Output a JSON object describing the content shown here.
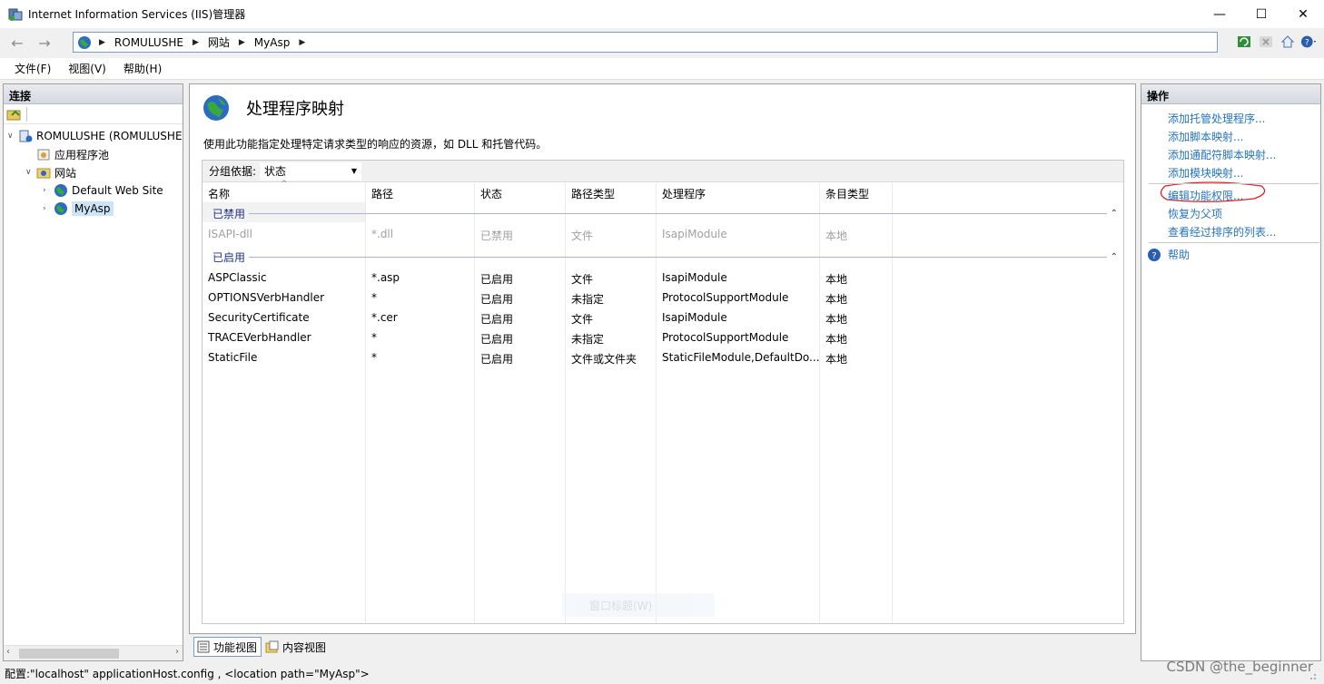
{
  "window": {
    "title": "Internet Information Services (IIS)管理器",
    "minimize": "—",
    "maximize": "☐",
    "close": "✕"
  },
  "address": {
    "back": "←",
    "forward": "→",
    "crumbs": [
      "ROMULUSHE",
      "网站",
      "MyAsp"
    ]
  },
  "menu": [
    "文件(F)",
    "视图(V)",
    "帮助(H)"
  ],
  "connections": {
    "header": "连接",
    "tree": [
      {
        "label": "ROMULUSHE (ROMULUSHE",
        "expanded": true
      },
      {
        "label": "应用程序池"
      },
      {
        "label": "网站",
        "expanded": true
      },
      {
        "label": "Default Web Site",
        "expanded": false
      },
      {
        "label": "MyAsp",
        "expanded": false,
        "selected": true
      }
    ]
  },
  "main": {
    "title": "处理程序映射",
    "description": "使用此功能指定处理特定请求类型的响应的资源，如 DLL 和托管代码。",
    "group_by_label": "分组依据:",
    "group_by_value": "状态",
    "columns": [
      "名称",
      "路径",
      "状态",
      "路径类型",
      "处理程序",
      "条目类型"
    ],
    "groups": [
      {
        "name": "已禁用",
        "rows": [
          [
            "ISAPI-dll",
            "*.dll",
            "已禁用",
            "文件",
            "IsapiModule",
            "本地"
          ]
        ]
      },
      {
        "name": "已启用",
        "rows": [
          [
            "ASPClassic",
            "*.asp",
            "已启用",
            "文件",
            "IsapiModule",
            "本地"
          ],
          [
            "OPTIONSVerbHandler",
            "*",
            "已启用",
            "未指定",
            "ProtocolSupportModule",
            "本地"
          ],
          [
            "SecurityCertificate",
            "*.cer",
            "已启用",
            "文件",
            "IsapiModule",
            "本地"
          ],
          [
            "TRACEVerbHandler",
            "*",
            "已启用",
            "未指定",
            "ProtocolSupportModule",
            "本地"
          ],
          [
            "StaticFile",
            "*",
            "已启用",
            "文件或文件夹",
            "StaticFileModule,DefaultDo...",
            "本地"
          ]
        ]
      }
    ],
    "ghost_text": "窗口标题(W)"
  },
  "viewtabs": [
    "功能视图",
    "内容视图"
  ],
  "actions": {
    "header": "操作",
    "items": [
      "添加托管处理程序...",
      "添加脚本映射...",
      "添加通配符脚本映射...",
      "添加模块映射..."
    ],
    "items2": [
      "编辑功能权限...",
      "恢复为父项",
      "查看经过排序的列表..."
    ],
    "help": "帮助"
  },
  "status": {
    "text": "配置:\"localhost\" applicationHost.config , <location path=\"MyAsp\">"
  },
  "watermark": "CSDN @the_beginner",
  "colors": {
    "link": "#2673c4",
    "group_header": "#1e3287",
    "annotation": "#e02020"
  }
}
